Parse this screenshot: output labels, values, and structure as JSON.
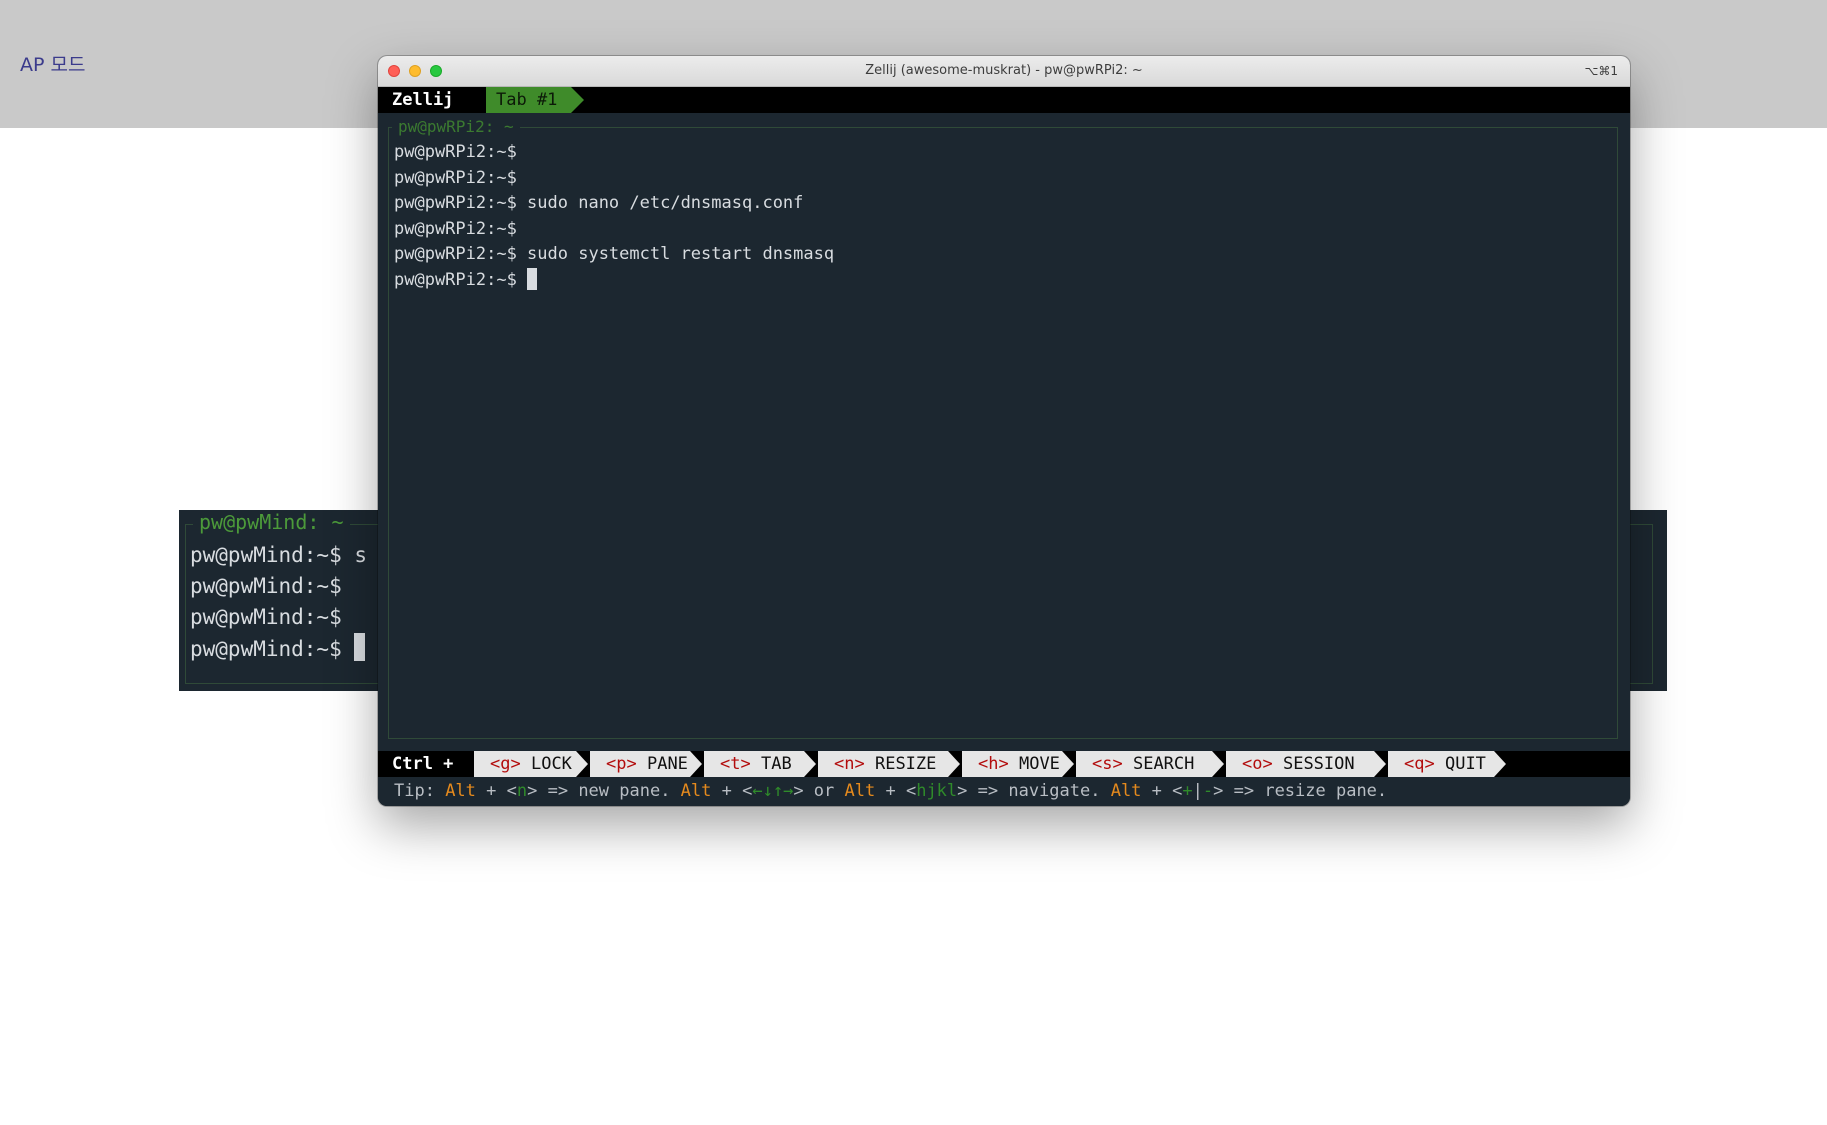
{
  "page": {
    "label": "AP 모드"
  },
  "background_terminal": {
    "pane_title": "pw@pwMind: ~",
    "lines": [
      "pw@pwMind:~$ s",
      "pw@pwMind:~$",
      "pw@pwMind:~$",
      "pw@pwMind:~$"
    ]
  },
  "window": {
    "title": "Zellij (awesome-muskrat) - pw@pwRPi2: ~",
    "shortcut": "⌥⌘1"
  },
  "tabbar": {
    "logo": "Zellij",
    "tab_label": "Tab #1"
  },
  "pane": {
    "title": "pw@pwRPi2: ~",
    "lines": [
      "pw@pwRPi2:~$",
      "pw@pwRPi2:~$",
      "pw@pwRPi2:~$ sudo nano /etc/dnsmasq.conf",
      "pw@pwRPi2:~$",
      "pw@pwRPi2:~$ sudo systemctl restart dnsmasq",
      "pw@pwRPi2:~$"
    ]
  },
  "statusbar": {
    "ctrl": "Ctrl +",
    "keys": [
      {
        "key": "<g>",
        "label": "LOCK"
      },
      {
        "key": "<p>",
        "label": "PANE"
      },
      {
        "key": "<t>",
        "label": "TAB"
      },
      {
        "key": "<n>",
        "label": "RESIZE"
      },
      {
        "key": "<h>",
        "label": "MOVE"
      },
      {
        "key": "<s>",
        "label": "SEARCH"
      },
      {
        "key": "<o>",
        "label": "SESSION"
      },
      {
        "key": "<q>",
        "label": "QUIT"
      }
    ]
  },
  "tip": {
    "prefix": "Tip: ",
    "alt": "Alt",
    "plus": " + ",
    "new_open": "<",
    "new_key": "n",
    "new_close": ">",
    "new_text": " => new pane. ",
    "nav_open": "<",
    "nav_arrows": "←↓↑→",
    "nav_close": ">",
    "or": " or ",
    "hjkl_open": "<",
    "hjkl": "hjkl",
    "hjkl_close": ">",
    "nav_text": " => navigate. ",
    "resize_open": "<",
    "resize_plus": "+",
    "resize_sep": "|",
    "resize_minus": "-",
    "resize_close": ">",
    "resize_text": " => resize pane."
  }
}
